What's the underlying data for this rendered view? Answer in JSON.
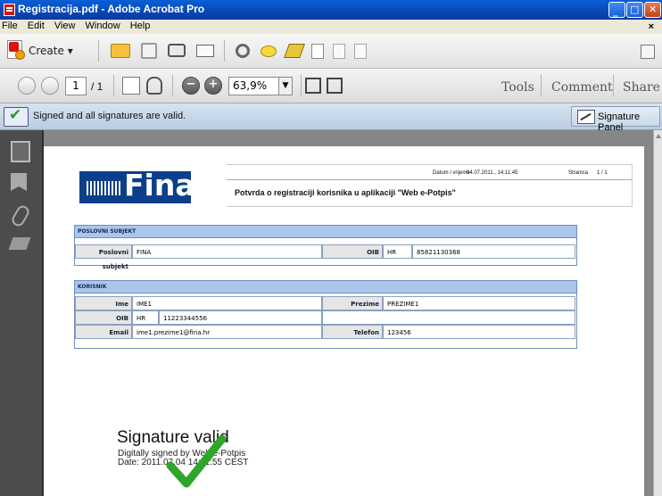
{
  "window": {
    "title": "Registracija.pdf - Adobe Acrobat Pro"
  },
  "menu": [
    "File",
    "Edit",
    "View",
    "Window",
    "Help"
  ],
  "toolbar": {
    "create_label": "Create"
  },
  "nav": {
    "page_current": "1",
    "page_total": "/ 1",
    "zoom": "63,9%"
  },
  "right_tabs": [
    "Tools",
    "Comment",
    "Share"
  ],
  "signature_bar": {
    "message": "Signed and all signatures are valid.",
    "panel_label": "Signature Panel"
  },
  "document": {
    "logo_text": "Fina",
    "date_label": "Datum i vrijeme",
    "date_value": "04.07.2011., 14:11:45",
    "page_label": "Stranica",
    "page_value": "1  /  1",
    "heading": "Potvrda o registraciji korisnika u aplikaciji \"Web e-Potpis\"",
    "subject": {
      "section": "POSLOVNI SUBJEKT",
      "label": "Poslovni subjekt",
      "value": "FINA",
      "oib_label": "OIB",
      "oib_country": "HR",
      "oib_value": "85821130368"
    },
    "user": {
      "section": "KORISNIK",
      "ime_label": "Ime",
      "ime_value": "IME1",
      "prezime_label": "Prezime",
      "prezime_value": "PREZIME1",
      "oib_label": "OIB",
      "oib_country": "HR",
      "oib_value": "11223344556",
      "email_label": "Email",
      "email_value": "ime1.prezime1@fina.hr",
      "telefon_label": "Telefon",
      "telefon_value": "123456"
    },
    "signature": {
      "title": "Signature valid",
      "line1": "Digitally signed by Web e-Potpis",
      "line2": "Date: 2011.07.04 14:11:55 CEST"
    }
  }
}
